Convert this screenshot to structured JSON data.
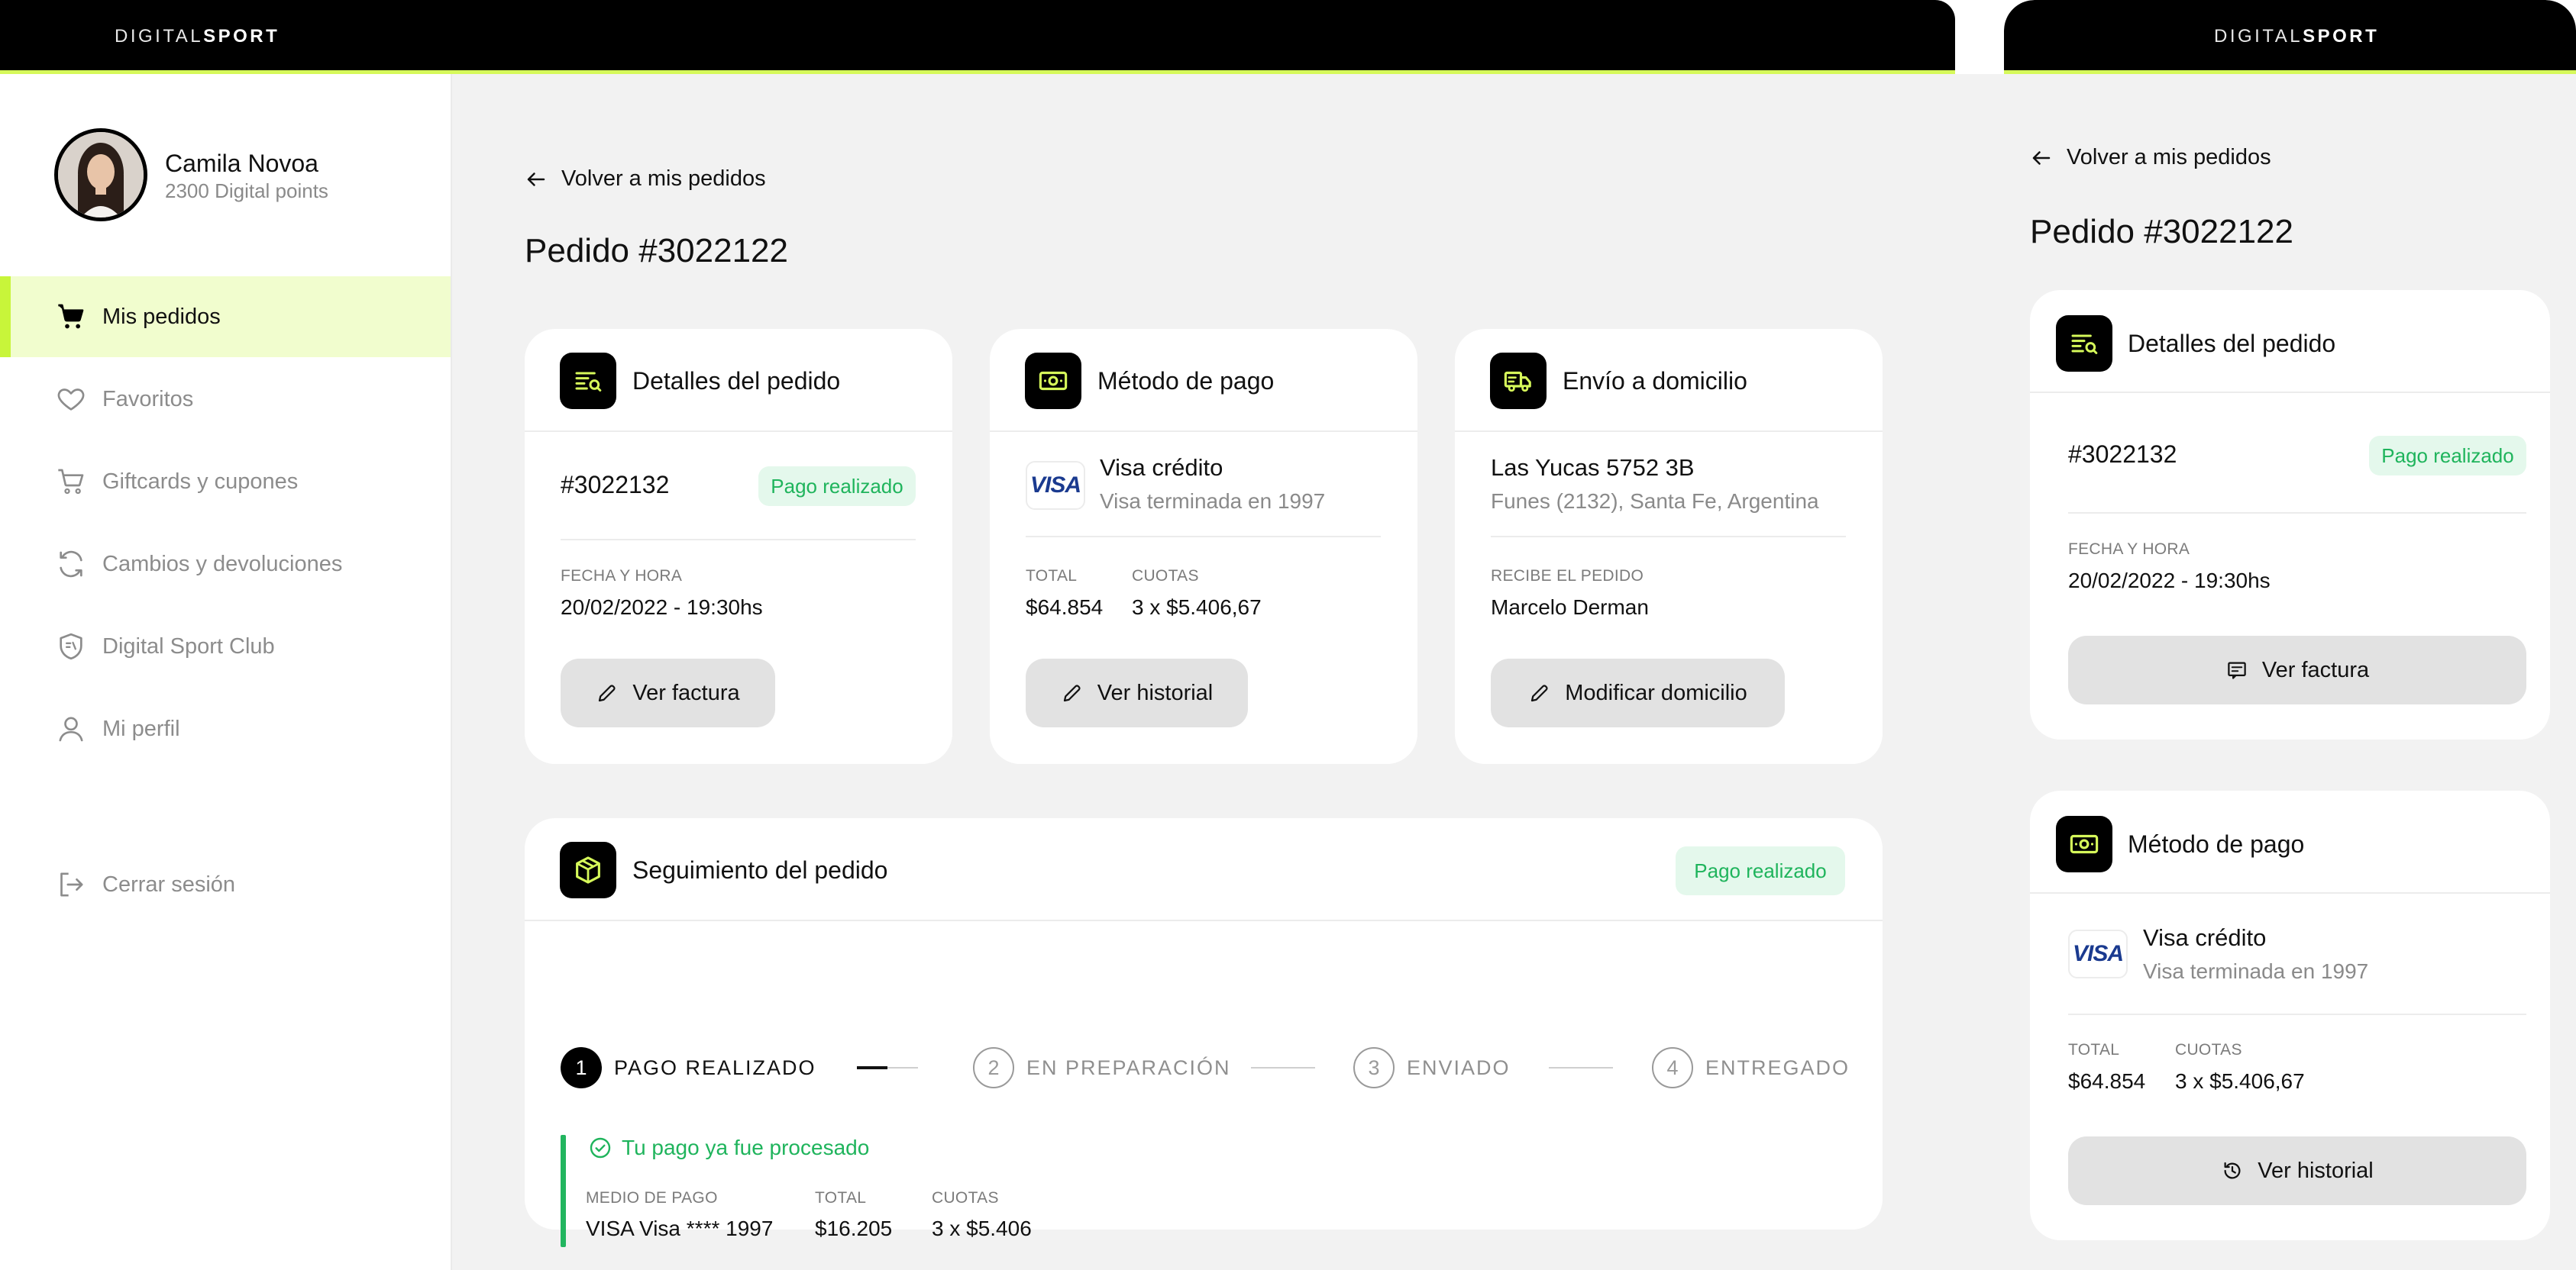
{
  "brand": {
    "light": "DIGITAL",
    "bold": "SPORT"
  },
  "colors": {
    "accent": "#d6f95a",
    "success": "#1fb45c",
    "badge_bg": "#e4f8ec",
    "black": "#000000"
  },
  "user": {
    "name": "Camila Novoa",
    "points": "2300 Digital points"
  },
  "nav": [
    {
      "label": "Mis pedidos",
      "icon": "cart-icon",
      "active": true
    },
    {
      "label": "Favoritos",
      "icon": "heart-icon",
      "active": false
    },
    {
      "label": "Giftcards y cupones",
      "icon": "shopping-cart-outline-icon",
      "active": false
    },
    {
      "label": "Cambios y devoluciones",
      "icon": "refresh-icon",
      "active": false
    },
    {
      "label": "Digital Sport Club",
      "icon": "shield-icon",
      "active": false
    },
    {
      "label": "Mi perfil",
      "icon": "user-icon",
      "active": false
    }
  ],
  "logout": {
    "label": "Cerrar sesión",
    "icon": "logout-icon"
  },
  "back_label": "Volver a mis pedidos",
  "page_title": "Pedido #3022122",
  "order_details": {
    "title": "Detalles del pedido",
    "order_number": "#3022132",
    "badge": "Pago realizado",
    "date_label": "FECHA Y HORA",
    "date_value": "20/02/2022 - 19:30hs",
    "button": "Ver factura"
  },
  "payment": {
    "title": "Método de pago",
    "card_brand": "VISA",
    "card_name": "Visa crédito",
    "card_sub": "Visa terminada en 1997",
    "total_label": "TOTAL",
    "total_value": "$64.854",
    "cuotas_label": "CUOTAS",
    "cuotas_value": "3 x $5.406,67",
    "button": "Ver historial"
  },
  "shipping": {
    "title": "Envío a domicilio",
    "address": "Las Yucas 5752 3B",
    "city": "Funes (2132), Santa Fe, Argentina",
    "receiver_label": "RECIBE EL PEDIDO",
    "receiver_value": "Marcelo Derman",
    "button": "Modificar domicilio"
  },
  "tracking": {
    "title": "Seguimiento del pedido",
    "badge": "Pago realizado",
    "steps": [
      {
        "num": "1",
        "label": "PAGO REALIZADO",
        "done": true
      },
      {
        "num": "2",
        "label": "EN PREPARACIÓN",
        "done": false
      },
      {
        "num": "3",
        "label": "ENVIADO",
        "done": false
      },
      {
        "num": "4",
        "label": "ENTREGADO",
        "done": false
      }
    ],
    "message": "Tu pago ya fue procesado",
    "medio_label": "MEDIO DE PAGO",
    "medio_value": "VISA Visa **** 1997",
    "total_label": "TOTAL",
    "total_value": "$16.205",
    "cuotas_label": "CUOTAS",
    "cuotas_value": "3 x $5.406"
  }
}
